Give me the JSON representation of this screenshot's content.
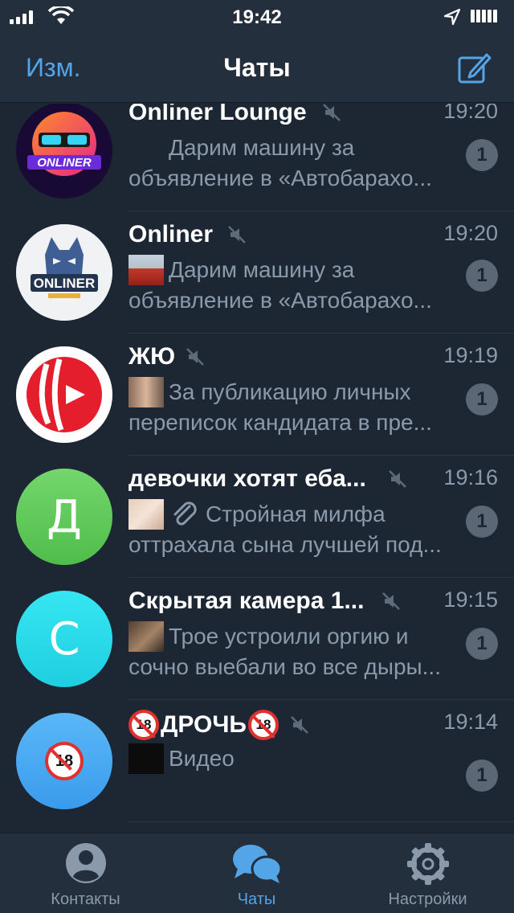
{
  "status": {
    "time": "19:42"
  },
  "nav": {
    "edit": "Изм.",
    "title": "Чаты"
  },
  "chats": [
    {
      "name": "Onliner Lounge",
      "time": "19:20",
      "line1": "Дарим машину за",
      "line2": "объявление в «Автобарахо...",
      "unread": "1",
      "avatar": "onliner-lounge-logo"
    },
    {
      "name": "Onliner",
      "time": "19:20",
      "line1": "Дарим машину за",
      "line2": "объявление в «Автобарахо...",
      "unread": "1",
      "avatar": "onliner-cat-logo"
    },
    {
      "name": "ЖЮ",
      "time": "19:19",
      "line1": "За публикацию личных",
      "line2": "переписок кандидата в пре...",
      "unread": "1",
      "avatar": "zhyu-logo"
    },
    {
      "name": "девочки хотят еба...",
      "time": "19:16",
      "line1": "Стройная милфа",
      "line2": "оттрахала сына лучшей под...",
      "unread": "1",
      "avatar_letter": "Д"
    },
    {
      "name": "Скрытая камера 1...",
      "time": "19:15",
      "line1": "Трое устроили оргию и",
      "line2": "сочно выебали во все дыры...",
      "unread": "1",
      "avatar_letter": "С"
    },
    {
      "name": "ДРОЧЬ",
      "time": "19:14",
      "line1": "Видео",
      "line2": "",
      "unread": "1",
      "avatar": "18-plus-icon"
    }
  ],
  "emoji18_label": "18",
  "tabs": [
    {
      "label": "Контакты",
      "icon": "person-icon"
    },
    {
      "label": "Чаты",
      "icon": "chats-icon"
    },
    {
      "label": "Настройки",
      "icon": "gear-icon"
    }
  ],
  "colors": {
    "accent": "#54a5e8",
    "background": "#1d2733",
    "bar": "#232f3d",
    "secondary_text": "#8b9aab"
  }
}
